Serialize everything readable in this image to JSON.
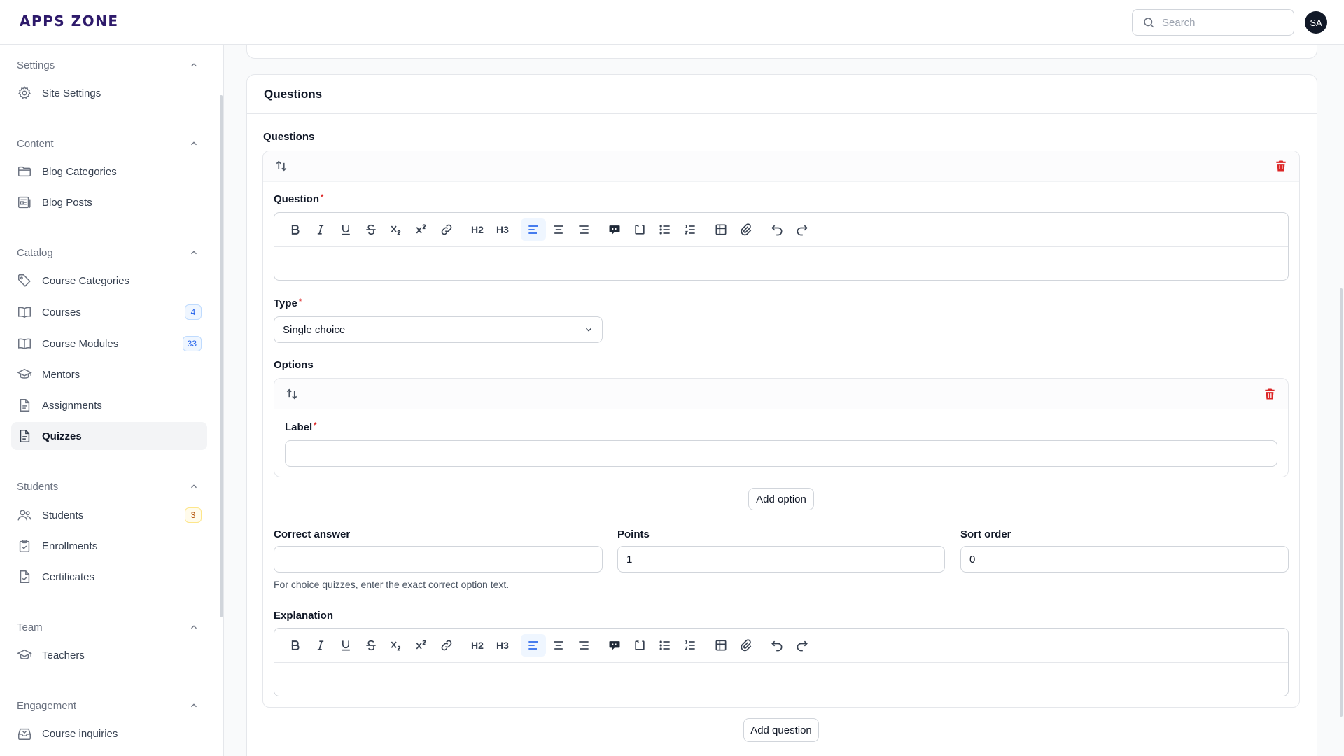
{
  "app": {
    "logo_text": "APPS ZONE"
  },
  "topbar": {
    "search_placeholder": "Search",
    "avatar_initials": "SA"
  },
  "sidebar": {
    "groups": [
      {
        "label": "Settings",
        "items": [
          {
            "label": "Site Settings",
            "icon": "gear-icon"
          }
        ]
      },
      {
        "label": "Content",
        "items": [
          {
            "label": "Blog Categories",
            "icon": "folder-icon"
          },
          {
            "label": "Blog Posts",
            "icon": "newspaper-icon"
          }
        ]
      },
      {
        "label": "Catalog",
        "items": [
          {
            "label": "Course Categories",
            "icon": "tag-icon"
          },
          {
            "label": "Courses",
            "icon": "book-icon",
            "badge": "4"
          },
          {
            "label": "Course Modules",
            "icon": "book-open-icon",
            "badge": "33"
          },
          {
            "label": "Mentors",
            "icon": "academic-cap-icon"
          },
          {
            "label": "Assignments",
            "icon": "document-icon"
          },
          {
            "label": "Quizzes",
            "icon": "document-text-icon",
            "active": true
          }
        ]
      },
      {
        "label": "Students",
        "items": [
          {
            "label": "Students",
            "icon": "users-icon",
            "badge": "3"
          },
          {
            "label": "Enrollments",
            "icon": "clipboard-icon"
          },
          {
            "label": "Certificates",
            "icon": "document-check-icon"
          }
        ]
      },
      {
        "label": "Team",
        "items": [
          {
            "label": "Teachers",
            "icon": "academic-cap-icon"
          }
        ]
      },
      {
        "label": "Engagement",
        "items": [
          {
            "label": "Course inquiries",
            "icon": "inbox-icon"
          }
        ]
      }
    ]
  },
  "main": {
    "section_title": "Questions",
    "repeater_label": "Questions",
    "question_label": "Question",
    "type_label": "Type",
    "type_value": "Single choice",
    "options_label": "Options",
    "option_label_label": "Label",
    "option_label_value": "",
    "add_option": "Add option",
    "correct_answer_label": "Correct answer",
    "correct_answer_value": "",
    "points_label": "Points",
    "points_value": "1",
    "sort_order_label": "Sort order",
    "sort_order_value": "0",
    "help_text": "For choice quizzes, enter the exact correct option text.",
    "explanation_label": "Explanation",
    "add_question": "Add question"
  },
  "editor_toolbar": {
    "heading2": "H2",
    "heading3": "H3",
    "icons": [
      "bold-icon",
      "italic-icon",
      "underline-icon",
      "strikethrough-icon",
      "subscript-icon",
      "superscript-icon",
      "link-icon",
      "heading-2-icon",
      "heading-3-icon",
      "align-left-icon",
      "align-center-icon",
      "align-right-icon",
      "blockquote-icon",
      "code-block-icon",
      "bullet-list-icon",
      "ordered-list-icon",
      "table-icon",
      "attach-icon",
      "undo-icon",
      "redo-icon"
    ]
  },
  "colors": {
    "accent": "#2563eb",
    "danger": "#dc2626",
    "brand": "#2e1a6b"
  }
}
